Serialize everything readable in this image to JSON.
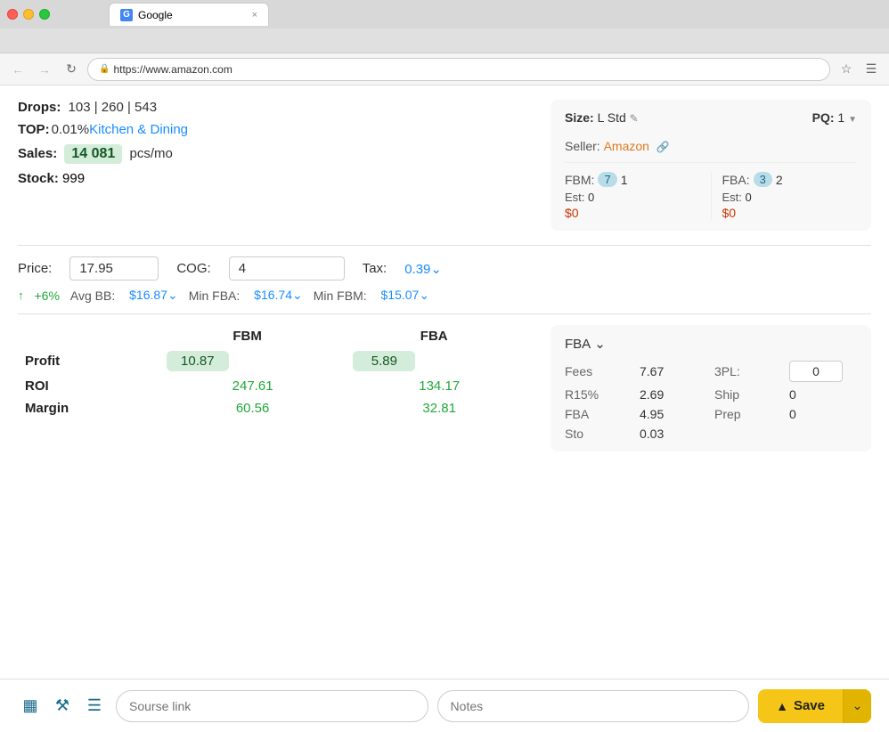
{
  "browser": {
    "tab_title": "Google",
    "tab_favicon": "G",
    "address": "https://www.amazon.com",
    "close_label": "×"
  },
  "product": {
    "drops_label": "Drops:",
    "drops_values": "103 | 260 | 543",
    "top_label": "TOP:",
    "top_percent": "0.01%",
    "category": "Kitchen & Dining",
    "sales_label": "Sales:",
    "sales_value": "14 081",
    "sales_unit": "pcs/mo",
    "stock_label": "Stock:",
    "stock_value": "999"
  },
  "size_pq": {
    "size_label": "Size:",
    "size_value": "L Std",
    "pq_label": "PQ:",
    "pq_value": "1"
  },
  "seller": {
    "label": "Seller:",
    "name": "Amazon"
  },
  "fbm": {
    "label": "FBM:",
    "count1": "7",
    "count2": "1",
    "est_label": "Est:",
    "est_value": "0",
    "price": "$0"
  },
  "fba": {
    "label": "FBA:",
    "count1": "3",
    "count2": "2",
    "est_label": "Est:",
    "est_value": "0",
    "price": "$0"
  },
  "pricing": {
    "price_label": "Price:",
    "price_value": "17.95",
    "cog_label": "COG:",
    "cog_value": "4",
    "tax_label": "Tax:",
    "tax_value": "0.39"
  },
  "bb_row": {
    "arrow": "↑",
    "percent": "+6%",
    "avg_bb_label": "Avg BB:",
    "avg_bb_value": "$16.87",
    "min_fba_label": "Min FBA:",
    "min_fba_value": "$16.74",
    "min_fbm_label": "Min FBM:",
    "min_fbm_value": "$15.07"
  },
  "profit_table": {
    "col_fbm": "FBM",
    "col_fba": "FBA",
    "rows": [
      {
        "label": "Profit",
        "fbm_value": "10.87",
        "fba_value": "5.89",
        "type": "badge"
      },
      {
        "label": "ROI",
        "fbm_value": "247.61",
        "fba_value": "134.17",
        "type": "plain"
      },
      {
        "label": "Margin",
        "fbm_value": "60.56",
        "fba_value": "32.81",
        "type": "plain"
      }
    ]
  },
  "fba_fees": {
    "header": "FBA",
    "fees_label": "Fees",
    "fees_value": "7.67",
    "tpl_label": "3PL:",
    "tpl_value": "0",
    "r15_label": "R15%",
    "r15_value": "2.69",
    "ship_label": "Ship",
    "ship_value": "0",
    "fba_label": "FBA",
    "fba_value": "4.95",
    "prep_label": "Prep",
    "prep_value": "0",
    "sto_label": "Sto",
    "sto_value": "0.03"
  },
  "bottom_bar": {
    "source_placeholder": "Sourse link",
    "notes_placeholder": "Notes",
    "save_label": "Save"
  }
}
